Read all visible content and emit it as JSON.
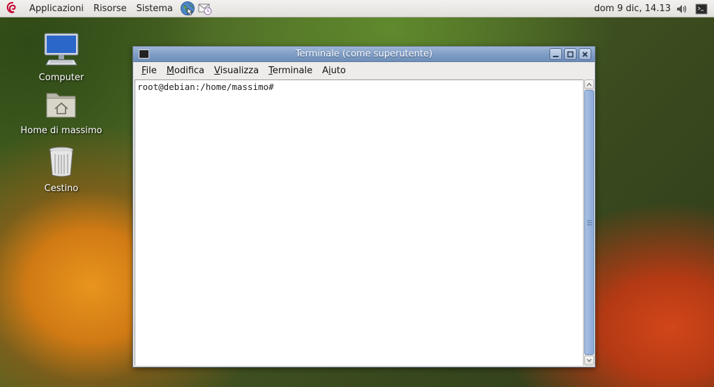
{
  "panel": {
    "menus": [
      "Applicazioni",
      "Risorse",
      "Sistema"
    ],
    "clock": "dom  9 dic, 14.13"
  },
  "desktop": {
    "icons": [
      {
        "label": "Computer"
      },
      {
        "label": "Home di massimo"
      },
      {
        "label": "Cestino"
      }
    ]
  },
  "window": {
    "title": "Terminale (come superutente)",
    "menu": [
      {
        "mnemonic": "F",
        "rest": "ile"
      },
      {
        "mnemonic": "M",
        "rest": "odifica"
      },
      {
        "mnemonic": "V",
        "rest": "isualizza"
      },
      {
        "mnemonic": "T",
        "rest": "erminale"
      },
      {
        "prefix": "A",
        "mnemonic": "i",
        "rest": "uto"
      }
    ],
    "prompt": "root@debian:/home/massimo#"
  },
  "colors": {
    "titlebar": "#7b9ac3",
    "scroll_thumb": "#8cabd8"
  }
}
